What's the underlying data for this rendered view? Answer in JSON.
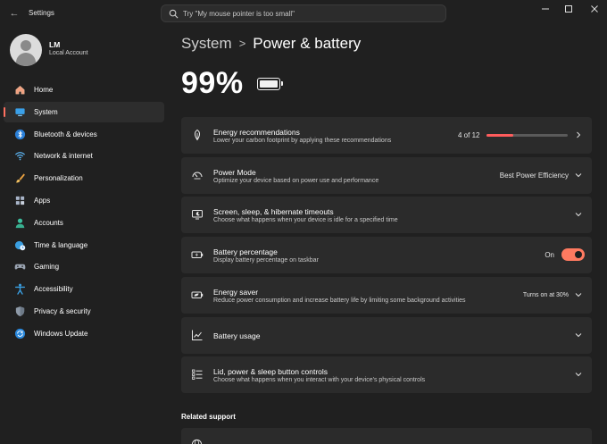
{
  "window": {
    "app_title": "Settings",
    "search_placeholder": "Try \"My mouse pointer is too small\"",
    "controls": [
      "minimize-icon",
      "maximize-icon",
      "close-icon"
    ]
  },
  "user": {
    "name": "LM",
    "account_type": "Local Account"
  },
  "sidebar": {
    "items": [
      {
        "label": "Home",
        "icon": "home-icon"
      },
      {
        "label": "System",
        "icon": "system-icon",
        "active": true
      },
      {
        "label": "Bluetooth & devices",
        "icon": "bluetooth-icon"
      },
      {
        "label": "Network & internet",
        "icon": "wifi-icon"
      },
      {
        "label": "Personalization",
        "icon": "brush-icon"
      },
      {
        "label": "Apps",
        "icon": "apps-icon"
      },
      {
        "label": "Accounts",
        "icon": "accounts-icon"
      },
      {
        "label": "Time & language",
        "icon": "globe-clock-icon"
      },
      {
        "label": "Gaming",
        "icon": "gamepad-icon"
      },
      {
        "label": "Accessibility",
        "icon": "accessibility-icon"
      },
      {
        "label": "Privacy & security",
        "icon": "shield-icon"
      },
      {
        "label": "Windows Update",
        "icon": "update-icon"
      }
    ]
  },
  "breadcrumb": {
    "parent": "System",
    "separator": ">",
    "current": "Power & battery"
  },
  "battery": {
    "percent_text": "99%",
    "level": 0.99
  },
  "cards": [
    {
      "title": "Energy recommendations",
      "subtitle": "Lower your carbon footprint by applying these recommendations",
      "value": "4 of 12",
      "progress": 0.33,
      "icon": "leaf-icon",
      "control": "chevron-right-icon"
    },
    {
      "title": "Power Mode",
      "subtitle": "Optimize your device based on power use and performance",
      "value": "Best Power Efficiency",
      "icon": "power-mode-icon",
      "control": "chevron-down-icon"
    },
    {
      "title": "Screen, sleep, & hibernate timeouts",
      "subtitle": "Choose what happens when your device is idle for a specified time",
      "icon": "screen-sleep-icon",
      "control": "chevron-down-icon"
    },
    {
      "title": "Battery percentage",
      "subtitle": "Display battery percentage on taskbar",
      "value": "On",
      "toggle_on": true,
      "icon": "battery-percentage-icon"
    },
    {
      "title": "Energy saver",
      "subtitle": "Reduce power consumption and increase battery life by limiting some background activities",
      "value": "Turns on at 30%",
      "icon": "energy-saver-icon",
      "control": "chevron-down-icon"
    },
    {
      "title": "Battery usage",
      "icon": "chart-line-icon",
      "control": "chevron-down-icon"
    },
    {
      "title": "Lid, power & sleep button controls",
      "subtitle": "Choose what happens when you interact with your device's physical controls",
      "icon": "checklist-icon",
      "control": "chevron-down-icon"
    }
  ],
  "related_support": {
    "heading": "Related support"
  },
  "colors": {
    "accent": "#ff7a60",
    "progress_fill": "#ff5c5c",
    "background": "#202020",
    "card": "#2b2b2b"
  }
}
